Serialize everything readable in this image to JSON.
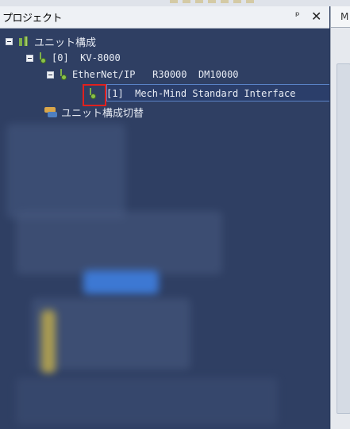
{
  "panel": {
    "title": "プロジェクト",
    "pin_glyph": "ᵖ",
    "close_glyph": "✕",
    "pin_icon": "pin-icon",
    "close_icon": "close-icon"
  },
  "right_tab": {
    "label": "M"
  },
  "tree": {
    "root": {
      "label": "ユニット構成",
      "icon": "unit-config-icon",
      "expanded": true
    },
    "controller": {
      "label": "[0]  KV-8000",
      "icon": "unit-icon",
      "expanded": true
    },
    "ethernet": {
      "label": "EtherNet/IP   R30000  DM10000",
      "icon": "unit-icon",
      "expanded": true
    },
    "device": {
      "label": "[1]  Mech-Mind Standard Interface",
      "icon": "device-icon",
      "selected": true,
      "highlighted": true
    },
    "switch": {
      "label": "ユニット構成切替",
      "icon": "switch-config-icon"
    }
  },
  "colors": {
    "tree_background": "#2f3f63",
    "selection_border": "#5a83c7",
    "highlight_box": "#e0201e"
  }
}
